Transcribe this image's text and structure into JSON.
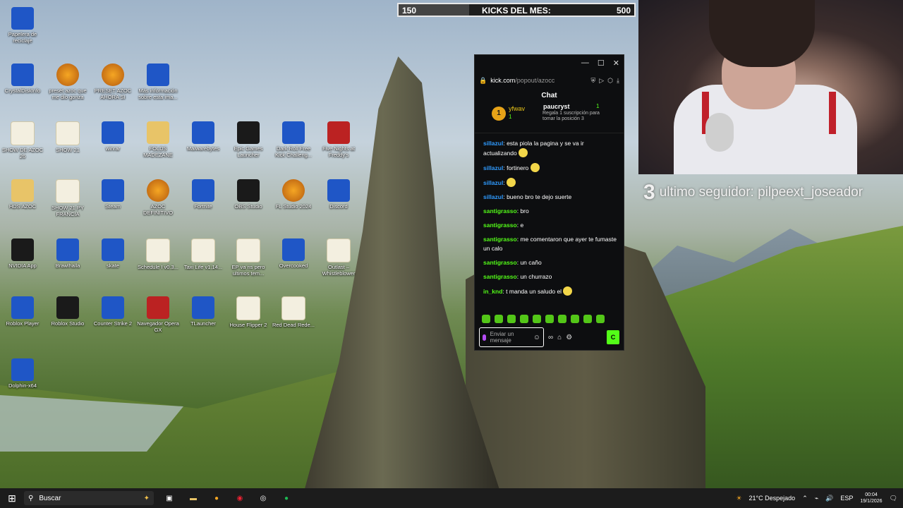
{
  "desktop": {
    "icons": [
      {
        "label": "Papelera de reciclaje",
        "icon": "recycle-bin-icon"
      },
      {
        "label": "CrystalDiskInfo",
        "icon": "crystaldisk-icon"
      },
      {
        "label": "preset azoc que me dio gonza",
        "icon": "fl-studio-icon"
      },
      {
        "label": "PRESET AZOC AHORA SI",
        "icon": "fl-studio-icon"
      },
      {
        "label": "Más información sobre esta ima...",
        "icon": "info-icon"
      },
      {
        "label": "SHOW DE AZOC 26",
        "icon": "file-icon"
      },
      {
        "label": "SHOW 21",
        "icon": "file-icon"
      },
      {
        "label": "winrar",
        "icon": "winrar-icon"
      },
      {
        "label": "FOLDS MADEZANE",
        "icon": "folder-icon"
      },
      {
        "label": "Malwarebytes",
        "icon": "malwarebytes-icon"
      },
      {
        "label": "Epic Games Launcher",
        "icon": "epic-games-icon"
      },
      {
        "label": "Dark Roll Free Kick Challeng...",
        "icon": "ball-icon"
      },
      {
        "label": "Five Nights at Freddy's",
        "icon": "fnaf-icon"
      },
      {
        "label": "HDS AZOC",
        "icon": "folder-icon"
      },
      {
        "label": "SHOW 21 PY FRANCIA",
        "icon": "file-icon"
      },
      {
        "label": "Steam",
        "icon": "steam-icon"
      },
      {
        "label": "AZOC DEFINITIVO",
        "icon": "fl-studio-icon"
      },
      {
        "label": "Fortnite",
        "icon": "fortnite-icon"
      },
      {
        "label": "OBS Studio",
        "icon": "obs-icon"
      },
      {
        "label": "FL Studio 2024",
        "icon": "fl-studio-icon"
      },
      {
        "label": "Discord",
        "icon": "discord-icon"
      },
      {
        "label": "NVIDIA App",
        "icon": "nvidia-icon"
      },
      {
        "label": "Brawlhalla",
        "icon": "brawlhalla-icon"
      },
      {
        "label": "skate",
        "icon": "skate-icon"
      },
      {
        "label": "Schedule I v0.3...",
        "icon": "file-icon"
      },
      {
        "label": "Taxi Life v1.14...",
        "icon": "file-icon"
      },
      {
        "label": "EP va ns pero ultimos tem...",
        "icon": "file-icon"
      },
      {
        "label": "Overcooked",
        "icon": "overcooked-icon"
      },
      {
        "label": "Outlast – Whistleblower",
        "icon": "file-icon"
      },
      {
        "label": "Roblox Player",
        "icon": "roblox-icon"
      },
      {
        "label": "Roblox Studio",
        "icon": "roblox-studio-icon"
      },
      {
        "label": "Counter Strike 2",
        "icon": "cs2-icon"
      },
      {
        "label": "Navegador Opera GX",
        "icon": "opera-gx-icon"
      },
      {
        "label": "TLauncher",
        "icon": "tlauncher-icon"
      },
      {
        "label": "House Flipper 2",
        "icon": "file-icon"
      },
      {
        "label": "Red Dead Rede...",
        "icon": "file-icon"
      },
      {
        "label": "Dolphin-x64",
        "icon": "dolphin-icon"
      }
    ]
  },
  "kicks_bar": {
    "start": "150",
    "label": "KICKS DEL MES:",
    "goal": "500",
    "progress": 0.3
  },
  "follower": {
    "count": "3",
    "text": "ultimo seguidor: pilpeext_joseador"
  },
  "chat_window": {
    "url_host": "kick.com",
    "url_path": "/popout/azocc",
    "title": "Chat",
    "sub_event": {
      "gift_count": "1",
      "user1": "yfwav",
      "user1_count": "1",
      "user2": "paucryst",
      "user2_count": "1",
      "text": "Regala 1 suscripción para tomar la posición 3"
    },
    "messages": [
      {
        "user": "sillazul",
        "color": "#2f9bff",
        "text": "esta piola la pagina y se va ir actualizando",
        "emoji": true
      },
      {
        "user": "sillazul",
        "color": "#2f9bff",
        "text": "fortinero",
        "emoji": true
      },
      {
        "user": "sillazul",
        "color": "#2f9bff",
        "text": "",
        "emoji": true
      },
      {
        "user": "sillazul",
        "color": "#2f9bff",
        "text": "bueno bro te dejo suerte",
        "emoji": false
      },
      {
        "user": "santigrasso",
        "color": "#53fc18",
        "text": "bro",
        "emoji": false
      },
      {
        "user": "santigrasso",
        "color": "#53fc18",
        "text": "e",
        "emoji": false
      },
      {
        "user": "santigrasso",
        "color": "#53fc18",
        "text": "me comentaron que ayer te fumaste un calo",
        "emoji": false
      },
      {
        "user": "santigrasso",
        "color": "#53fc18",
        "text": "un caño",
        "emoji": false
      },
      {
        "user": "santigrasso",
        "color": "#53fc18",
        "text": "un churrazo",
        "emoji": false
      },
      {
        "user": "in_knd",
        "color": "#53fc18",
        "text": "t manda un saludo el",
        "emoji": true
      }
    ],
    "input_placeholder": "Enviar un mensaje",
    "send_label": "C"
  },
  "taskbar": {
    "search_placeholder": "Buscar",
    "weather": "21°C Despejado",
    "language": "ESP",
    "time": "00:04",
    "date": "19/1/2026"
  }
}
